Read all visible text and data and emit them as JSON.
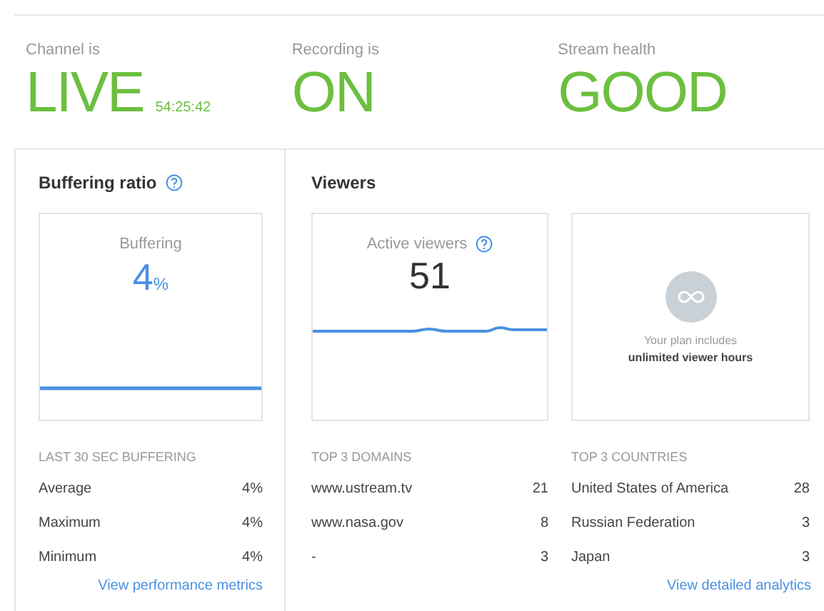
{
  "status": [
    {
      "label": "Channel is",
      "value": "LIVE",
      "extra": "54:25:42"
    },
    {
      "label": "Recording is",
      "value": "ON"
    },
    {
      "label": "Stream health",
      "value": "GOOD"
    }
  ],
  "buffering": {
    "title": "Buffering ratio",
    "card": {
      "label": "Buffering",
      "value": "4",
      "unit": "%"
    },
    "section_title": "LAST 30 SEC BUFFERING",
    "rows": [
      {
        "label": "Average",
        "value": "4%"
      },
      {
        "label": "Maximum",
        "value": "4%"
      },
      {
        "label": "Minimum",
        "value": "4%"
      }
    ],
    "link": "View performance metrics"
  },
  "viewers": {
    "title": "Viewers",
    "active_card": {
      "label": "Active viewers",
      "value": "51"
    },
    "plan_card": {
      "line1": "Your plan includes",
      "line2": "unlimited viewer hours"
    },
    "domains": {
      "title": "TOP 3 DOMAINS",
      "rows": [
        {
          "label": "www.ustream.tv",
          "value": "21"
        },
        {
          "label": "www.nasa.gov",
          "value": "8"
        },
        {
          "label": "-",
          "value": "3"
        }
      ]
    },
    "countries": {
      "title": "TOP 3 COUNTRIES",
      "rows": [
        {
          "label": "United States of America",
          "value": "28"
        },
        {
          "label": "Russian Federation",
          "value": "3"
        },
        {
          "label": "Japan",
          "value": "3"
        }
      ]
    },
    "link": "View detailed analytics"
  }
}
